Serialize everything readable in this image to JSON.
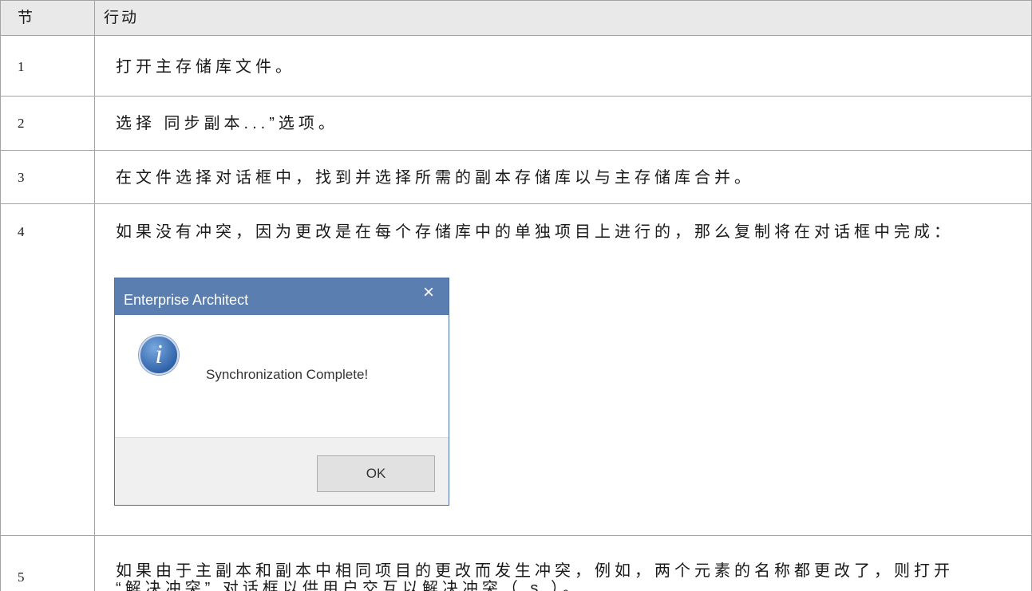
{
  "table": {
    "headers": {
      "step": "节",
      "action": "行动"
    },
    "rows": [
      {
        "step": "1",
        "action": "打开主存储库文件。"
      },
      {
        "step": "2",
        "action": "选择 同步副本...”选项。"
      },
      {
        "step": "3",
        "action": "在文件选择对话框中，找到并选择所需的副本存储库以与主存储库合并。"
      },
      {
        "step": "4",
        "action": "如果没有冲突，因为更改是在每个存储库中的单独项目上进行的，那么复制将在对话框中完成："
      },
      {
        "step": "5",
        "action_lines": [
          "如果由于主副本和副本中相同项目的更改而发生冲突，例如，两个元素的名称都更改了，则打开",
          "“解决冲突” 对话框以供用户交互以解决冲突（ s ）。"
        ]
      }
    ]
  },
  "dialog": {
    "title": "Enterprise Architect",
    "close_glyph": "×",
    "icon": "info-icon",
    "icon_glyph": "i",
    "message": "Synchronization Complete!",
    "ok_label": "OK"
  },
  "colors": {
    "text": "#1a1a1a",
    "grid": "#a3a3a3",
    "header_bg": "#e9e9e9",
    "titlebar": "#5a7eb0",
    "title_text": "#ffffff",
    "dialog_border": "#4f719f",
    "dialog_text": "#333333",
    "icon_light": "#79a8e0",
    "icon_dark": "#2f62a8",
    "footer_bg": "#f0f0f0",
    "footer_line": "#dcdcdc",
    "ok_bg": "#e1e1e1",
    "ok_border": "#adadad"
  }
}
